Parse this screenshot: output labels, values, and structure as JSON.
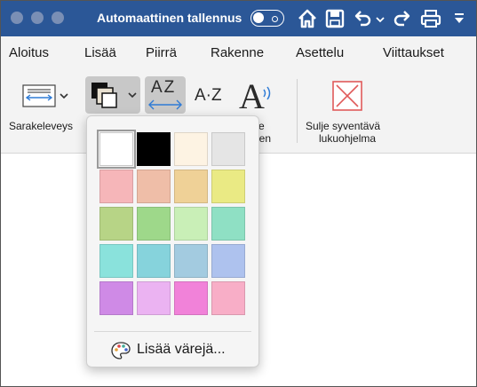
{
  "titlebar": {
    "autosave_label": "Automaattinen tallennus",
    "autosave_on": false,
    "icons": [
      "home-icon",
      "save-icon",
      "undo-icon",
      "redo-icon",
      "print-icon",
      "customize-icon"
    ]
  },
  "tabs": [
    "Aloitus",
    "Lisää",
    "Piirrä",
    "Rakenne",
    "Asettelu",
    "Viittaukset"
  ],
  "ribbon": {
    "column_width_label": "Sarakeleveys",
    "text_spacing_partial": "e",
    "read_aloud_partial": "een",
    "close_reader_line1": "Sulje syventävä",
    "close_reader_line2": "lukuohjelma",
    "syllables_icon_text": "A·Z",
    "text_spacing_icon_text": "AZ",
    "read_aloud_icon_text": "A"
  },
  "page_color_menu": {
    "colors": [
      [
        "#ffffff",
        "#000000",
        "#fdf3e3",
        "#e5e5e5"
      ],
      [
        "#f6b6b9",
        "#efbea8",
        "#efd197",
        "#eaea84"
      ],
      [
        "#b7d486",
        "#9ed88a",
        "#c9efb7",
        "#8fe0c4"
      ],
      [
        "#8ae2dc",
        "#86d3dc",
        "#a3cbe0",
        "#aec2ee"
      ],
      [
        "#cf8ae6",
        "#ebb3f2",
        "#f182d9",
        "#f8aec7"
      ]
    ],
    "selected": "#ffffff",
    "more_colors_label": "Lisää värejä..."
  }
}
